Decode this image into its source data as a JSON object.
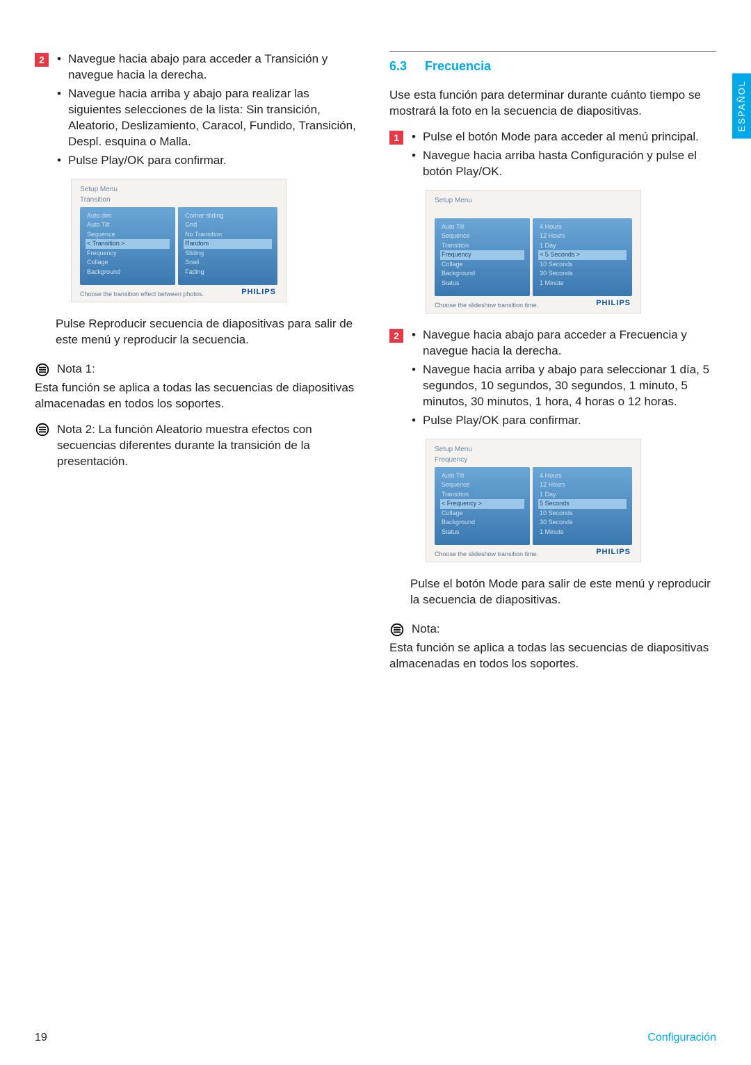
{
  "language_tab": "ESPAÑOL",
  "left": {
    "step2_num": "2",
    "step2_items": [
      "Navegue hacia abajo para acceder a Transición y navegue hacia la derecha.",
      "Navegue hacia arriba y abajo para realizar las siguientes selecciones de la lista: Sin transición, Aleatorio, Deslizamiento, Caracol, Fundido, Transición, Despl. esquina o Malla.",
      "Pulse Play/OK para confirmar."
    ],
    "shot1": {
      "crumb1": "Setup Menu",
      "crumb2": "Transition",
      "left_items": [
        "Auto dim",
        "Auto Tilt",
        "Sequence",
        "Transition",
        "Frequency",
        "Collage",
        "Background"
      ],
      "left_highlight": "Transition",
      "right_items": [
        "Corner sliding",
        "Grid",
        "No Transition",
        "Random",
        "Sliding",
        "Snail",
        "Fading"
      ],
      "right_highlight": "Random",
      "hint": "Choose the transition effect between photos.",
      "logo": "PHILIPS"
    },
    "post_shot1": "Pulse Reproducir secuencia de diapositivas para salir de este menú y reproducir la secuencia.",
    "note1_label": "Nota 1:",
    "note1_body": "Esta función se aplica a todas las secuencias de diapositivas almacenadas en todos los    soportes.",
    "note2_full": "Nota 2: La función Aleatorio muestra efectos con secuencias diferentes durante la transición de la presentación."
  },
  "right": {
    "section_num": "6.3",
    "section_title": "Frecuencia",
    "intro": "Use esta función para determinar durante cuánto tiempo se mostrará la foto en la secuencia de diapositivas.",
    "step1_num": "1",
    "step1_items": [
      "Pulse el botón Mode para acceder al menú principal.",
      "Navegue hacia arriba hasta Configuración y pulse el botón Play/OK."
    ],
    "shot2": {
      "crumb1": "Setup Menu",
      "crumb2": "",
      "left_items": [
        "Auto Tilt",
        "Sequence",
        "Transition",
        "Frequency",
        "Collage",
        "Background",
        "Status"
      ],
      "left_highlight": "Frequency",
      "right_items": [
        "4 Hours",
        "12 Hours",
        "1 Day",
        "5 Seconds",
        "10 Seconds",
        "30 Seconds",
        "1 Minute"
      ],
      "right_highlight": "5 Seconds",
      "right_sel_mode": true,
      "hint": "Choose the slideshow transition time.",
      "logo": "PHILIPS"
    },
    "step2_num": "2",
    "step2_items": [
      "Navegue hacia abajo para acceder a Frecuencia y navegue hacia la derecha.",
      "Navegue hacia arriba y abajo para seleccionar 1 día, 5 segundos, 10 segundos, 30 segundos, 1 minuto, 5 minutos, 30 minutos, 1 hora, 4 horas o 12 horas.",
      "Pulse Play/OK para confirmar."
    ],
    "shot3": {
      "crumb1": "Setup Menu",
      "crumb2": "Frequency",
      "left_items": [
        "Auto Tilt",
        "Sequence",
        "Transition",
        "Frequency",
        "Collage",
        "Background",
        "Status"
      ],
      "left_highlight": "Frequency",
      "right_items": [
        "4 Hours",
        "12 Hours",
        "1 Day",
        "5 Seconds",
        "10 Seconds",
        "30 Seconds",
        "1 Minute"
      ],
      "right_highlight": "5 Seconds",
      "hint": "Choose the slideshow transition time.",
      "logo": "PHILIPS"
    },
    "post_shot3": "Pulse el botón Mode para salir de este menú y reproducir la secuencia de diapositivas.",
    "note_label": "Nota:",
    "note_body": "Esta función se aplica a todas las secuencias de diapositivas almacenadas en todos los soportes."
  },
  "footer": {
    "page": "19",
    "section": "Configuración"
  }
}
